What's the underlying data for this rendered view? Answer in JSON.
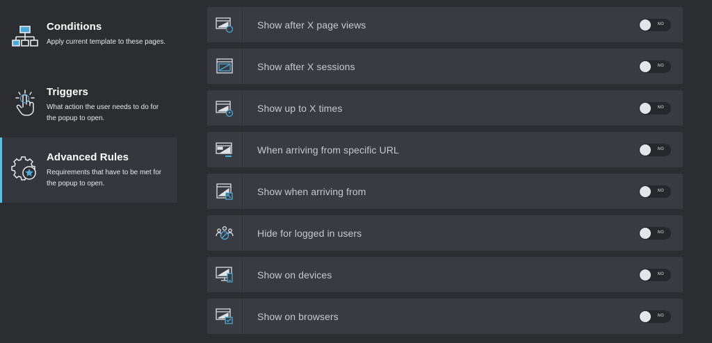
{
  "sidebar": {
    "items": [
      {
        "title": "Conditions",
        "description": "Apply current template to these pages.",
        "icon": "sitemap-icon",
        "active": false
      },
      {
        "title": "Triggers",
        "description": "What action the user needs to do for the popup to open.",
        "icon": "tap-hand-icon",
        "active": false
      },
      {
        "title": "Advanced Rules",
        "description": "Requirements that have to be met for the popup to open.",
        "icon": "gear-star-icon",
        "active": true
      }
    ]
  },
  "rules": [
    {
      "label": "Show after X page views",
      "icon": "page-views-icon",
      "toggle": "NO"
    },
    {
      "label": "Show after X sessions",
      "icon": "sessions-icon",
      "toggle": "NO"
    },
    {
      "label": "Show up to X times",
      "icon": "times-icon",
      "toggle": "NO"
    },
    {
      "label": "When arriving from specific URL",
      "icon": "url-icon",
      "toggle": "NO"
    },
    {
      "label": "Show when arriving from",
      "icon": "arriving-from-icon",
      "toggle": "NO"
    },
    {
      "label": "Hide for logged in users",
      "icon": "users-icon",
      "toggle": "NO"
    },
    {
      "label": "Show on devices",
      "icon": "devices-icon",
      "toggle": "NO"
    },
    {
      "label": "Show on browsers",
      "icon": "browsers-icon",
      "toggle": "NO"
    }
  ],
  "colors": {
    "accent": "#5bc0de",
    "row_background": "#393b42",
    "page_background": "#2b2d31"
  }
}
